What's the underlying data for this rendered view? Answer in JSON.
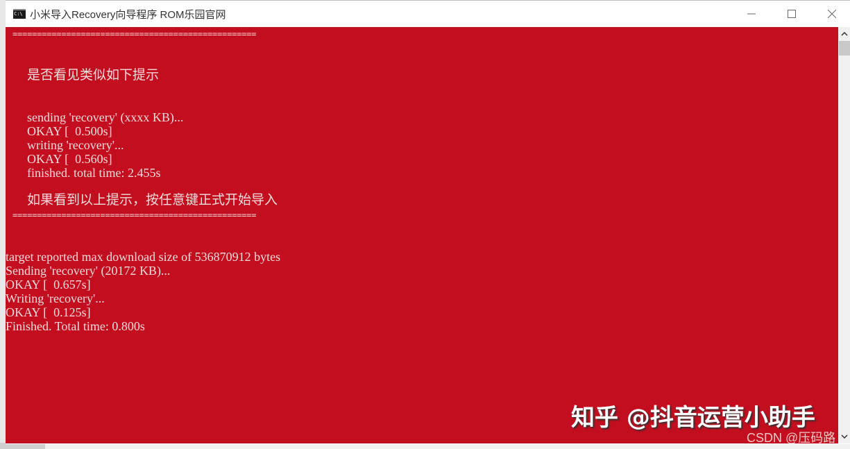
{
  "window": {
    "title": "小米导入Recovery向导程序 ROM乐园官网",
    "icon": "cmd-icon",
    "controls": {
      "minimize": "—",
      "maximize": "☐",
      "close": "✕"
    }
  },
  "console": {
    "background_color": "#c30e1f",
    "text_color": "#f3dcdc",
    "separator": "==================================================",
    "prompt_heading": "是否看见类似如下提示",
    "example_lines": [
      "sending 'recovery' (xxxx KB)...",
      "OKAY [  0.500s]",
      "writing 'recovery'...",
      "OKAY [  0.560s]",
      "finished. total time: 2.455s"
    ],
    "instruction": "如果看到以上提示，按任意键正式开始导入",
    "output_lines": [
      "target reported max download size of 536870912 bytes",
      "Sending 'recovery' (20172 KB)...",
      "OKAY [  0.657s]",
      "Writing 'recovery'...",
      "OKAY [  0.125s]",
      "Finished. Total time: 0.800s"
    ]
  },
  "watermarks": {
    "zhihu": "知乎 @抖音运营小助手",
    "csdn": "CSDN @压码路"
  },
  "scrollbar": {
    "up": "⌃",
    "down": "⌄"
  }
}
